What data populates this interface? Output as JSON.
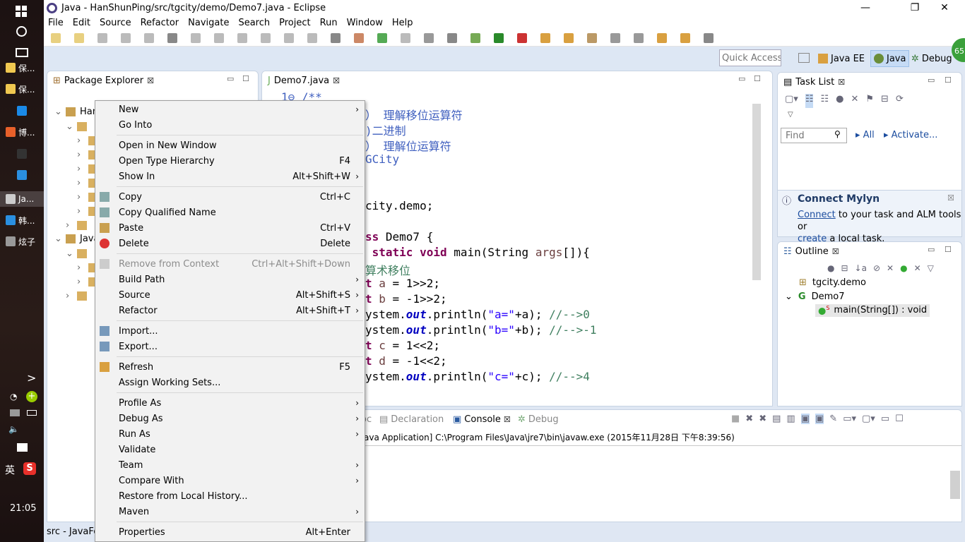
{
  "taskbar": {
    "items": [
      {
        "label": "保...",
        "icon": "folder-icon",
        "color": "#f0c850"
      },
      {
        "label": "保...",
        "icon": "folder-icon",
        "color": "#f0c850"
      },
      {
        "label": "",
        "icon": "kugou-icon",
        "color": "#1a8ae8"
      },
      {
        "label": "博...",
        "icon": "firefox-icon",
        "color": "#e8602a"
      },
      {
        "label": "",
        "icon": "cmd-icon",
        "color": "#333333"
      },
      {
        "label": "",
        "icon": "ie-icon",
        "color": "#2a8fe0"
      },
      {
        "label": "Ja...",
        "icon": "eclipse-icon",
        "color": "#cccccc"
      },
      {
        "label": "韩...",
        "icon": "chat-icon",
        "color": "#2a8fe0"
      },
      {
        "label": "炫子",
        "icon": "app-icon",
        "color": "#999999"
      }
    ],
    "ime": "英",
    "clock": "21:05"
  },
  "window": {
    "title": "Java - HanShunPing/src/tgcity/demo/Demo7.java - Eclipse"
  },
  "menu": [
    "File",
    "Edit",
    "Source",
    "Refactor",
    "Navigate",
    "Search",
    "Project",
    "Run",
    "Window",
    "Help"
  ],
  "perspective": {
    "quick_access": "Quick Access",
    "items": [
      "Java EE",
      "Java",
      "Debug"
    ],
    "active": "Java",
    "badge": "65"
  },
  "package_explorer": {
    "tab": "Package Explorer",
    "visible_nodes": [
      "Han",
      "Java"
    ]
  },
  "editor": {
    "tab": "Demo7.java",
    "first_line": "1⊖ /**",
    "lines": [
      [
        [
          "jd",
          "） 理解移位运算符"
        ]
      ],
      [
        [
          "jd",
          ")二进制"
        ]
      ],
      [
        [
          "jd",
          "） 理解位运算符"
        ]
      ],
      [
        [
          "jd",
          "GCity"
        ]
      ],
      [],
      [],
      [
        [
          "",
          "city.demo;"
        ]
      ],
      [],
      [
        [
          "kw",
          "ss"
        ],
        [
          "",
          " Demo7 {"
        ]
      ],
      [
        [
          "kw",
          " static void"
        ],
        [
          "",
          " main(String "
        ],
        [
          "lv",
          "args"
        ],
        [
          "",
          "[]){"
        ]
      ],
      [
        [
          "cm",
          "算术移位"
        ]
      ],
      [
        [
          "kw",
          "t"
        ],
        [
          "lv",
          " a"
        ],
        [
          "",
          " = 1>>2;"
        ]
      ],
      [
        [
          "kw",
          "t"
        ],
        [
          "lv",
          " b"
        ],
        [
          "",
          " = -1>>2;"
        ]
      ],
      [
        [
          "",
          "ystem."
        ],
        [
          "fl",
          "out"
        ],
        [
          "",
          ".println("
        ],
        [
          "st",
          "\"a=\""
        ],
        [
          "",
          "+a); "
        ],
        [
          "cm",
          "//-->0"
        ]
      ],
      [
        [
          "",
          "ystem."
        ],
        [
          "fl",
          "out"
        ],
        [
          "",
          ".println("
        ],
        [
          "st",
          "\"b=\""
        ],
        [
          "",
          "+b); "
        ],
        [
          "cm",
          "//-->-1"
        ]
      ],
      [
        [
          "kw",
          "t"
        ],
        [
          "lv",
          " c"
        ],
        [
          "",
          " = 1<<2;"
        ]
      ],
      [
        [
          "kw",
          "t"
        ],
        [
          "lv",
          " d"
        ],
        [
          "",
          " = -1<<2;"
        ]
      ],
      [
        [
          "",
          "ystem."
        ],
        [
          "fl",
          "out"
        ],
        [
          "",
          ".println("
        ],
        [
          "st",
          "\"c=\""
        ],
        [
          "",
          "+c); "
        ],
        [
          "cm",
          "//-->4"
        ]
      ]
    ]
  },
  "context_menu": [
    {
      "label": "New",
      "arrow": true
    },
    {
      "label": "Go Into"
    },
    {
      "sep": true
    },
    {
      "label": "Open in New Window"
    },
    {
      "label": "Open Type Hierarchy",
      "shortcut": "F4"
    },
    {
      "label": "Show In",
      "shortcut": "Alt+Shift+W",
      "arrow": true
    },
    {
      "sep": true
    },
    {
      "label": "Copy",
      "shortcut": "Ctrl+C",
      "icon": "copy-icon"
    },
    {
      "label": "Copy Qualified Name",
      "icon": "copy-qualified-icon"
    },
    {
      "label": "Paste",
      "shortcut": "Ctrl+V",
      "icon": "paste-icon"
    },
    {
      "label": "Delete",
      "shortcut": "Delete",
      "icon": "delete-icon"
    },
    {
      "sep": true
    },
    {
      "label": "Remove from Context",
      "shortcut": "Ctrl+Alt+Shift+Down",
      "disabled": true,
      "icon": "remove-context-icon"
    },
    {
      "label": "Build Path",
      "arrow": true
    },
    {
      "label": "Source",
      "shortcut": "Alt+Shift+S",
      "arrow": true
    },
    {
      "label": "Refactor",
      "shortcut": "Alt+Shift+T",
      "arrow": true
    },
    {
      "sep": true
    },
    {
      "label": "Import...",
      "icon": "import-icon"
    },
    {
      "label": "Export...",
      "icon": "export-icon"
    },
    {
      "sep": true
    },
    {
      "label": "Refresh",
      "shortcut": "F5",
      "icon": "refresh-icon"
    },
    {
      "label": "Assign Working Sets..."
    },
    {
      "sep": true
    },
    {
      "label": "Profile As",
      "arrow": true
    },
    {
      "label": "Debug As",
      "arrow": true
    },
    {
      "label": "Run As",
      "arrow": true
    },
    {
      "label": "Validate"
    },
    {
      "label": "Team",
      "arrow": true
    },
    {
      "label": "Compare With",
      "arrow": true
    },
    {
      "label": "Restore from Local History..."
    },
    {
      "label": "Maven",
      "arrow": true
    },
    {
      "sep": true
    },
    {
      "label": "Properties",
      "shortcut": "Alt+Enter"
    }
  ],
  "task_list": {
    "tab": "Task List",
    "find_placeholder": "Find",
    "all": "All",
    "activate": "Activate..."
  },
  "mylyn": {
    "title": "Connect Mylyn",
    "connect": "Connect",
    "text1": " to your task and ALM tools or",
    "create": "create",
    "text2": " a local task."
  },
  "outline": {
    "tab": "Outline",
    "package": "tgcity.demo",
    "class": "Demo7",
    "method": "main(String[]) : void"
  },
  "console": {
    "tabs": [
      "oc",
      "Declaration",
      "Console",
      "Debug"
    ],
    "active": "Console",
    "header": "ava Application] C:\\Program Files\\Java\\jre7\\bin\\javaw.exe (2015年11月28日 下午8:39:56)"
  },
  "status": {
    "text": "src - JavaFo"
  }
}
